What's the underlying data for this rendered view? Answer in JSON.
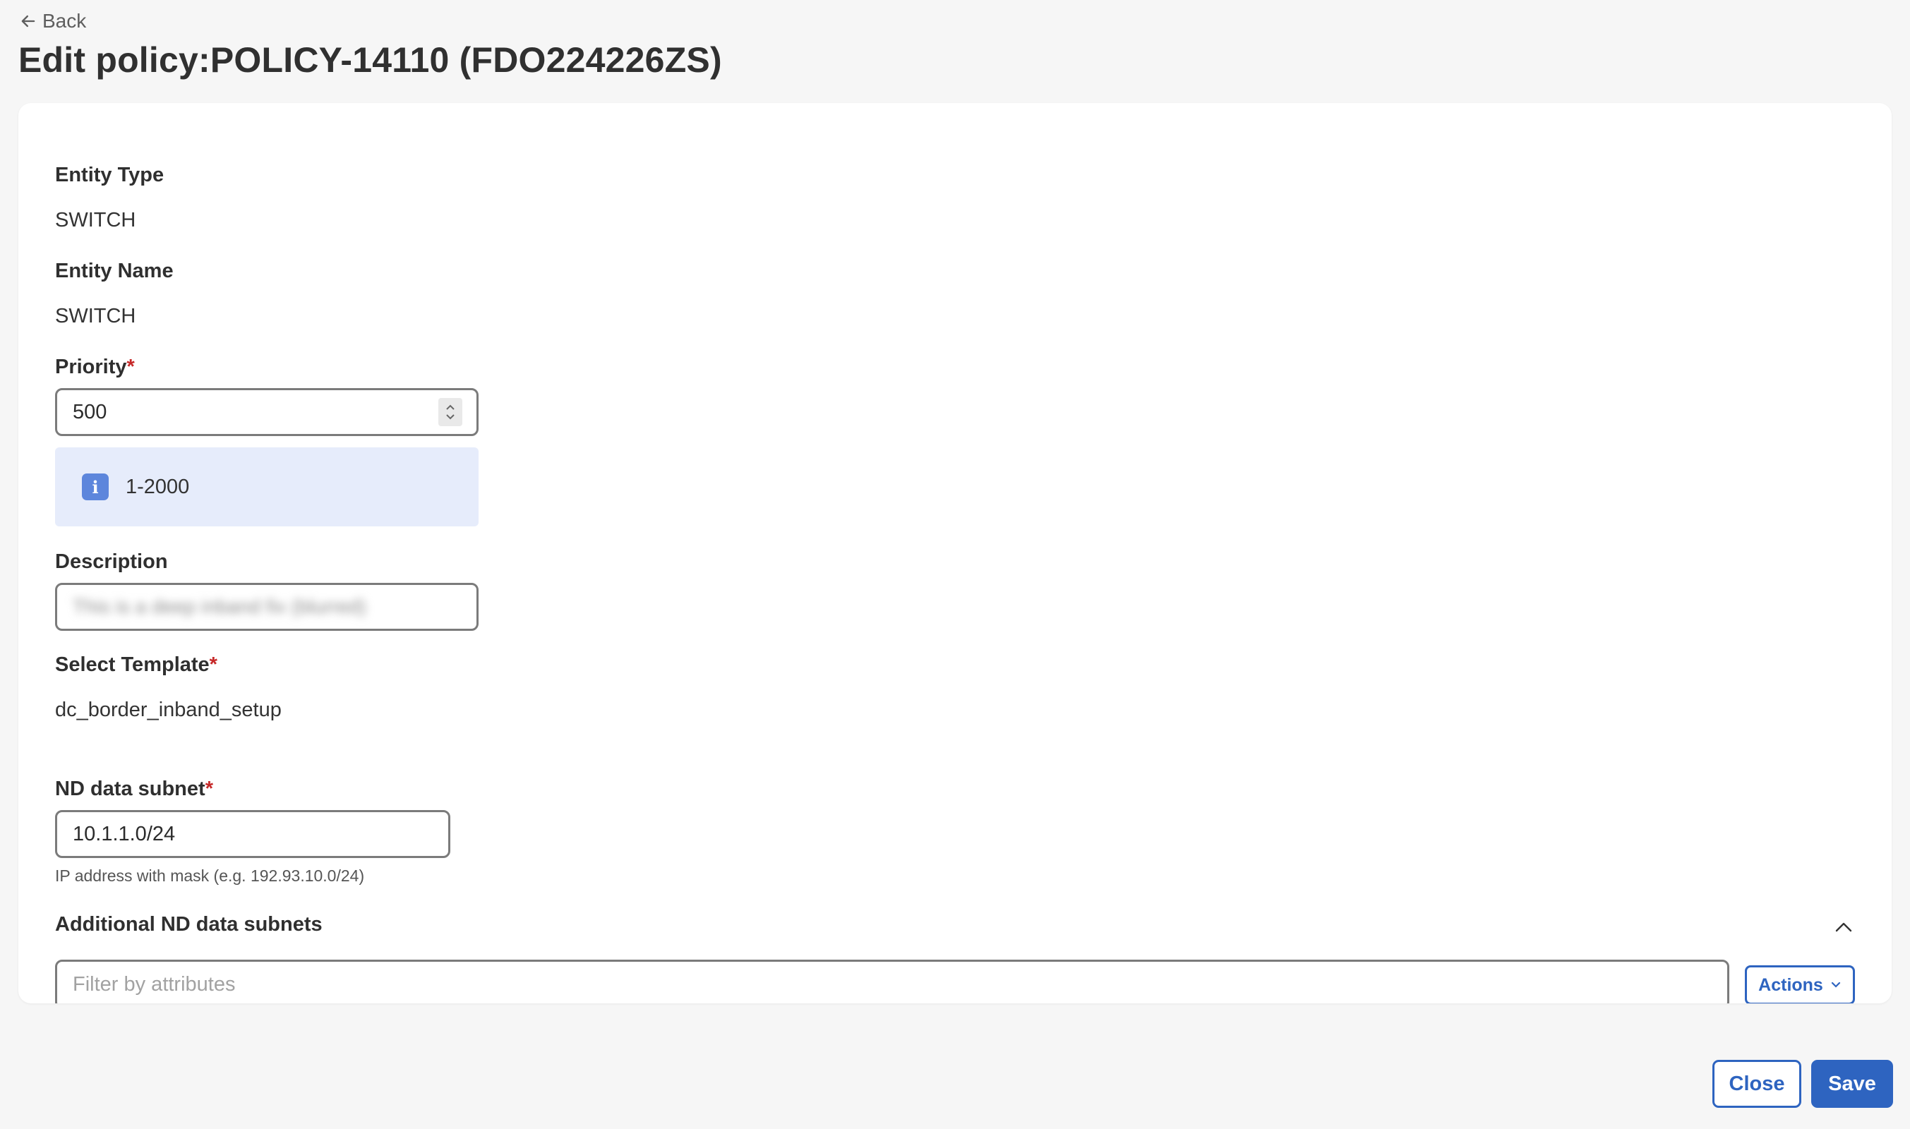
{
  "header": {
    "back_label": "Back",
    "title": "Edit policy:POLICY-14110 (FDO224226ZS)"
  },
  "form": {
    "entity_type": {
      "label": "Entity Type",
      "value": "SWITCH"
    },
    "entity_name": {
      "label": "Entity Name",
      "value": "SWITCH"
    },
    "priority": {
      "label": "Priority",
      "required_mark": "*",
      "value": "500",
      "hint": "1-2000"
    },
    "description": {
      "label": "Description",
      "value": "This is a deep inband fix (blurred)"
    },
    "template": {
      "label": "Select Template",
      "required_mark": "*",
      "value": "dc_border_inband_setup"
    },
    "nd_data_subnet": {
      "label": "ND data subnet",
      "required_mark": "*",
      "value": "10.1.1.0/24",
      "helper": "IP address with mask (e.g. 192.93.10.0/24)"
    },
    "additional_subnets": {
      "label": "Additional ND data subnets",
      "filter_placeholder": "Filter by attributes",
      "actions_label": "Actions"
    }
  },
  "footer": {
    "close_label": "Close",
    "save_label": "Save"
  },
  "colors": {
    "primary": "#2e64c0",
    "required": "#c62828",
    "info_bg": "#e6ecfb",
    "info_icon": "#5d86dc"
  }
}
